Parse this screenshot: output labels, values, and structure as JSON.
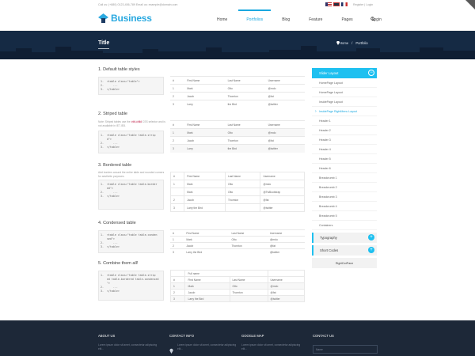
{
  "topbar": {
    "contact": "Call us: (+880) 0123-456-789    Email us: example@domain.com",
    "register": "Register",
    "separator": "|",
    "login": "Login"
  },
  "brand": {
    "name": "Business",
    "color": "#2aa9e0"
  },
  "nav": {
    "items": [
      "Home",
      "Portfolios",
      "Blog",
      "Feature",
      "Pages",
      "Login"
    ],
    "active": "Portfolios",
    "search_icon": "search-icon"
  },
  "banner": {
    "title": "Title",
    "breadcrumb": [
      "Home",
      "Portfolio"
    ],
    "breadcrumb_separator": "/"
  },
  "sections": {
    "default": {
      "title": "1. Default table styles",
      "code": "1.  <table class=\"table\">\n2.      ...\n3.  </table>",
      "headers": [
        "#",
        "First Name",
        "Last Name",
        "Username"
      ],
      "rows": [
        [
          "1",
          "Mark",
          "Otto",
          "@mdo"
        ],
        [
          "2",
          "Jacob",
          "Thornton",
          "@fat"
        ],
        [
          "3",
          "Larry",
          "the Bird",
          "@twitter"
        ]
      ]
    },
    "striped": {
      "title": "2. Striped table",
      "note_prefix": "Note: Striped tables use the",
      "note_chip": ":nth-child",
      "note_suffix": "CSS selector and is not available in IE7-IE8.",
      "code": "1.  <table class=\"table table-strip\n    d\">\n2.      ...\n3.  </table>",
      "headers": [
        "#",
        "First Name",
        "Last Name",
        "Username"
      ],
      "rows": [
        [
          "1",
          "Mark",
          "Otto",
          "@mdo"
        ],
        [
          "2",
          "Jacob",
          "Thornton",
          "@fat"
        ],
        [
          "3",
          "Larry",
          "the Bird",
          "@twitter"
        ]
      ]
    },
    "bordered": {
      "title": "3. Bordered table",
      "note": "Add borders around the entire table and rounded corners for aesthetic purposes.",
      "code": "1.  <table class=\"table table-border\n    ed\">\n2.      ...\n3.  </table>",
      "headers": [
        "#",
        "First Name",
        "Last Name",
        "Username"
      ],
      "rows": [
        [
          "1",
          "Mark",
          "Otto",
          "@mdo"
        ],
        [
          "",
          "Mark",
          "Otto",
          "@TwBootstrap"
        ],
        [
          "2",
          "Jacob",
          "Thornton",
          "@fat"
        ],
        [
          "3",
          "Larry the Bird",
          "",
          "@twitter"
        ]
      ]
    },
    "condensed": {
      "title": "4. Condensed table",
      "code": "1.  <table class=\"table table-conden\n    sed\">\n2.      ...\n3.  </table>",
      "headers": [
        "#",
        "First Name",
        "Last Name",
        "Username"
      ],
      "rows": [
        [
          "1",
          "Mark",
          "Otto",
          "@mdo"
        ],
        [
          "2",
          "Jacob",
          "Thornton",
          "@fat"
        ],
        [
          "3",
          "Larry the Bird",
          "",
          "@twitter"
        ]
      ]
    },
    "combined": {
      "title": "5. Combine them all!",
      "code": "1.  <table class=\"table table-strip\n    ed table-bordered table-condensed\n    \">\n2.      ...\n3.  </table>",
      "group_header": "Full name",
      "headers": [
        "#",
        "First Name",
        "Last Name",
        "Username"
      ],
      "rows": [
        [
          "1",
          "Mark",
          "Otto",
          "@mdo"
        ],
        [
          "2",
          "Jacob",
          "Thornton",
          "@fat"
        ],
        [
          "3",
          "Larry the Bird",
          "",
          "@twitter"
        ]
      ]
    }
  },
  "sidebar": {
    "head": "Slider Layout",
    "toggle_minus": "−",
    "items": [
      "HomePage Layout",
      "HomePage Layout",
      "InsidePage Layout",
      "InsidePage RightMenu Layout",
      "Header 1",
      "Header 2",
      "Header 3",
      "Header 4",
      "Header 5",
      "Header 6",
      "Breadcrumb 1",
      "Breadcrumb 2",
      "Breadcrumb 3",
      "Breadcrumb 4",
      "Breadcrumb 5",
      "Containers"
    ],
    "active_index": 3,
    "panels": [
      "Typography",
      "Short Codes"
    ],
    "toggle_plus": "+",
    "right_dot": "RightDotPane"
  },
  "footer": {
    "columns": [
      "ABOUT US",
      "CONTACT INFO",
      "GOOGLE MAP",
      "CONTACT US"
    ],
    "texts": [
      "Lorem ipsum dolor sit amet, consectetur adipiscing elit...",
      "Lorem ipsum dolor sit amet, consectetur adipiscing elit...",
      "Lorem ipsum dolor sit amet, consectetur adipiscing elit..."
    ],
    "name_placeholder": "Name"
  },
  "colors": {
    "accent": "#1ec0f0",
    "banner": "#152a44",
    "footer": "#1d2838"
  }
}
